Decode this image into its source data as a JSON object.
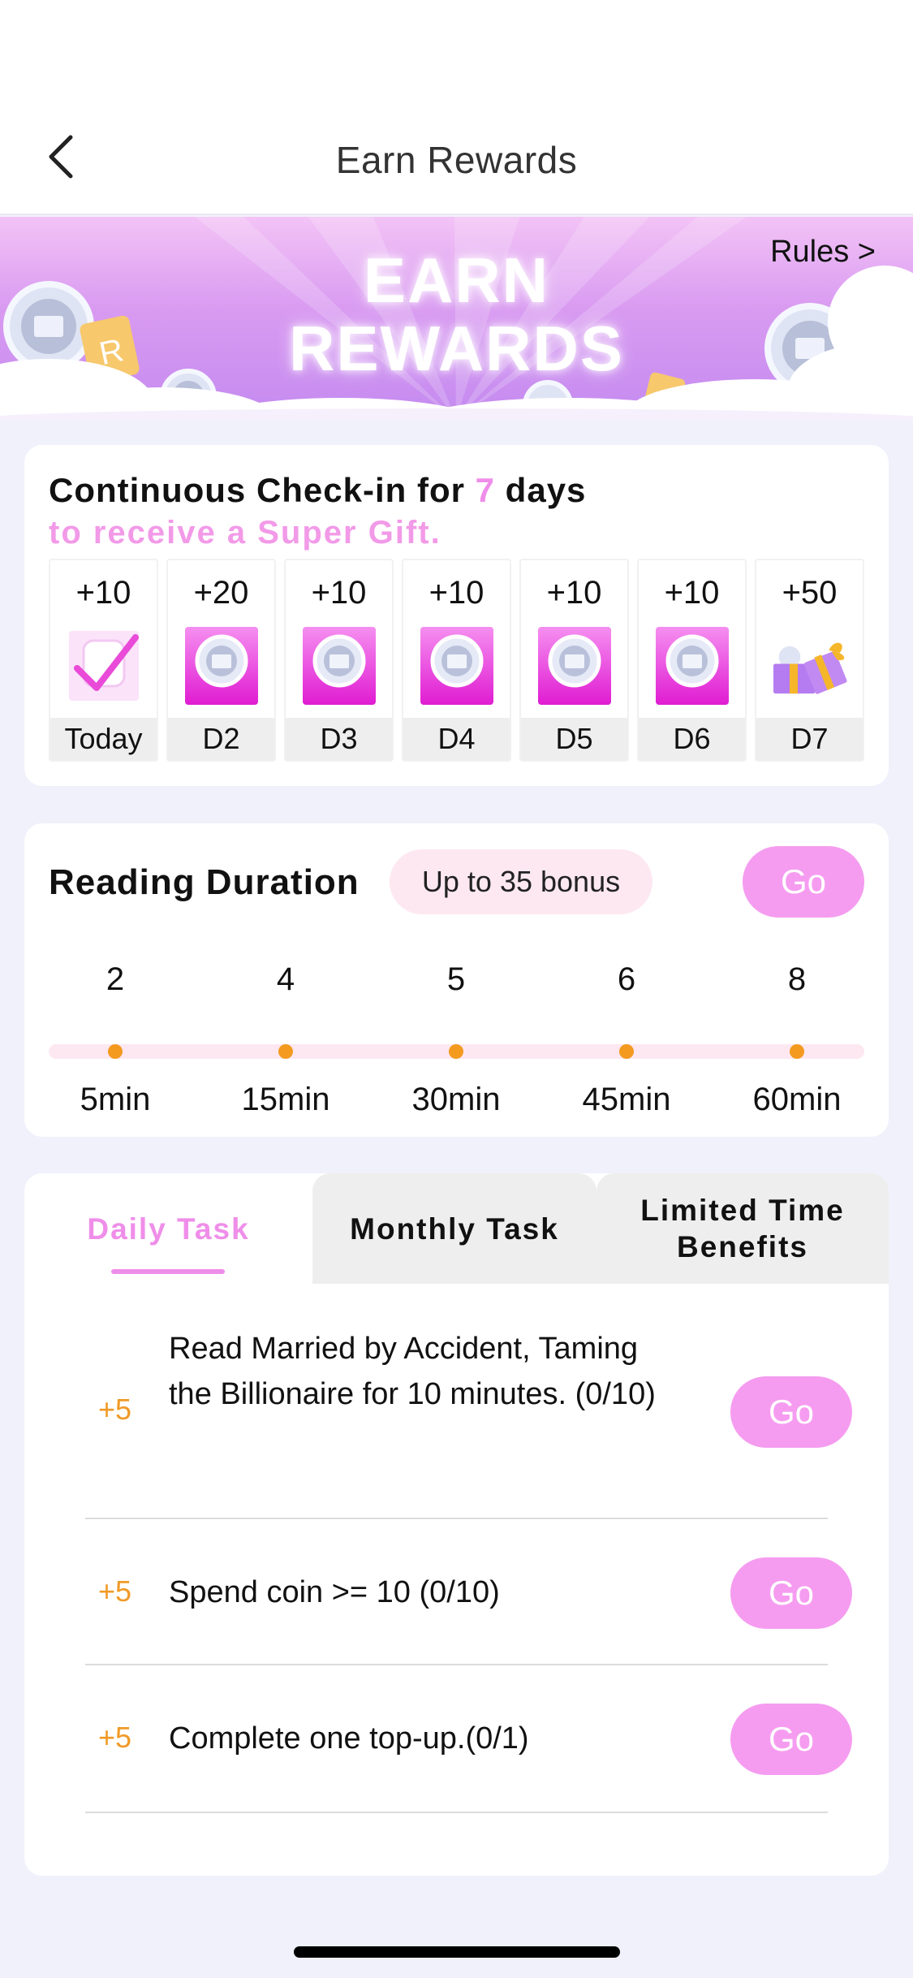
{
  "header": {
    "title": "Earn Rewards",
    "back_icon": "chevron-left-icon"
  },
  "banner": {
    "title_line1": "EARN",
    "title_line2": "REWARDS",
    "rules_link": "Rules >"
  },
  "checkin": {
    "line1_prefix": "Continuous Check-in for ",
    "line1_days": "7",
    "line1_suffix": " days",
    "line2": "to receive a Super Gift.",
    "days": [
      {
        "points": "+10",
        "label": "Today",
        "icon": "checkmark-icon"
      },
      {
        "points": "+20",
        "label": "D2",
        "icon": "book-coin-icon"
      },
      {
        "points": "+10",
        "label": "D3",
        "icon": "book-coin-icon"
      },
      {
        "points": "+10",
        "label": "D4",
        "icon": "book-coin-icon"
      },
      {
        "points": "+10",
        "label": "D5",
        "icon": "book-coin-icon"
      },
      {
        "points": "+10",
        "label": "D6",
        "icon": "book-coin-icon"
      },
      {
        "points": "+50",
        "label": "D7",
        "icon": "gift-box-icon"
      }
    ]
  },
  "reading": {
    "title": "Reading Duration",
    "bonus": "Up to 35 bonus",
    "go_label": "Go",
    "milestones": [
      {
        "points": "2",
        "time": "5min"
      },
      {
        "points": "4",
        "time": "15min"
      },
      {
        "points": "5",
        "time": "30min"
      },
      {
        "points": "6",
        "time": "45min"
      },
      {
        "points": "8",
        "time": "60min"
      }
    ]
  },
  "tasks": {
    "tabs": [
      {
        "label": "Daily Task"
      },
      {
        "label": "Monthly Task"
      },
      {
        "label": "Limited Time Benefits"
      }
    ],
    "items": [
      {
        "points": "+5",
        "text": "Read Married by Accident, Taming the Billionaire for 10 minutes. (0/10)",
        "go_label": "Go"
      },
      {
        "points": "+5",
        "text": "Spend coin >= 10 (0/10)",
        "go_label": "Go"
      },
      {
        "points": "+5",
        "text": "Complete one top-up.(0/1)",
        "go_label": "Go"
      }
    ]
  },
  "colors": {
    "accent_pink": "#ef8ee9",
    "go_button": "#f59cf0",
    "bonus_pill_bg": "#fde8f1",
    "milestone_dot": "#f39a1f",
    "task_points": "#f09a27"
  }
}
